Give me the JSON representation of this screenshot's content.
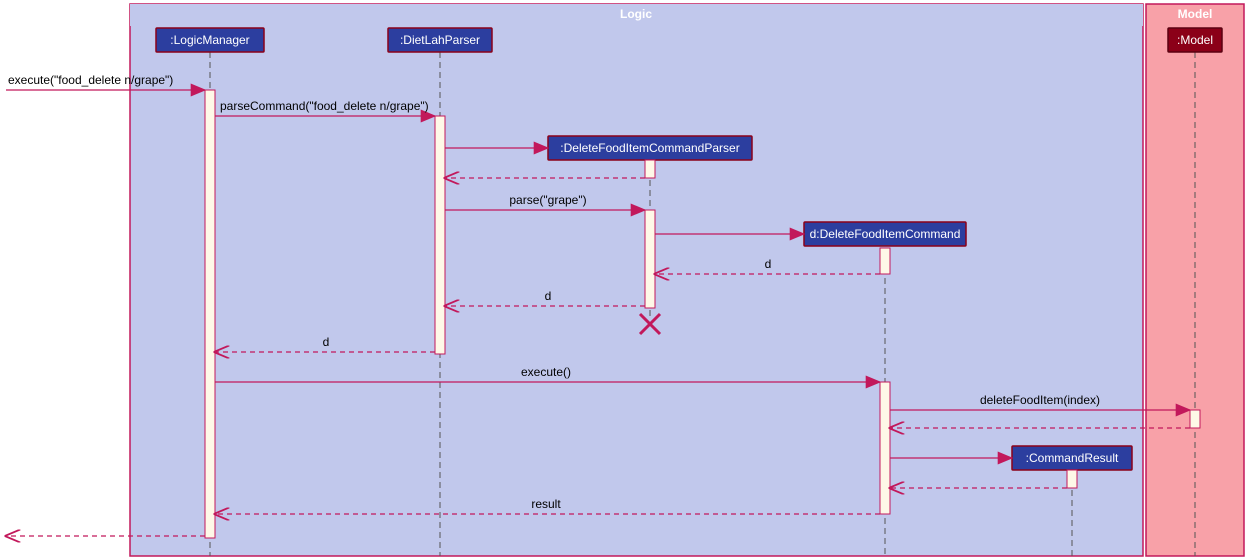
{
  "frames": {
    "logic": {
      "title": "Logic"
    },
    "model": {
      "title": "Model"
    }
  },
  "lifelines": {
    "logicManager": {
      "label": ":LogicManager"
    },
    "dietLahParser": {
      "label": ":DietLahParser"
    },
    "dfiParser": {
      "label": ":DeleteFoodItemCommandParser"
    },
    "dfiCommand": {
      "label": "d:DeleteFoodItemCommand"
    },
    "cmdResult": {
      "label": ":CommandResult"
    },
    "model": {
      "label": ":Model"
    }
  },
  "messages": {
    "m1": "execute(\"food_delete n/grape\")",
    "m2": "parseCommand(\"food_delete n/grape\")",
    "m3": "",
    "m4": "parse(\"grape\")",
    "m5": "",
    "m6": "d",
    "m7": "d",
    "m8": "d",
    "m9": "execute()",
    "m10": "deleteFoodItem(index)",
    "m11": "",
    "m12": "",
    "m13": "result",
    "m14": ""
  },
  "chart_data": {
    "type": "sequence-diagram",
    "frames": [
      {
        "name": "Logic",
        "contains": [
          "LogicManager",
          "DietLahParser",
          "DeleteFoodItemCommandParser",
          "d:DeleteFoodItemCommand",
          "CommandResult"
        ]
      },
      {
        "name": "Model",
        "contains": [
          "Model"
        ]
      }
    ],
    "lifelines": [
      ":LogicManager",
      ":DietLahParser",
      ":DeleteFoodItemCommandParser",
      "d:DeleteFoodItemCommand",
      ":CommandResult",
      ":Model"
    ],
    "interactions": [
      {
        "from": "external",
        "to": ":LogicManager",
        "label": "execute(\"food_delete n/grape\")",
        "type": "sync"
      },
      {
        "from": ":LogicManager",
        "to": ":DietLahParser",
        "label": "parseCommand(\"food_delete n/grape\")",
        "type": "sync"
      },
      {
        "from": ":DietLahParser",
        "to": ":DeleteFoodItemCommandParser",
        "label": "",
        "type": "create"
      },
      {
        "from": ":DeleteFoodItemCommandParser",
        "to": ":DietLahParser",
        "label": "",
        "type": "return"
      },
      {
        "from": ":DietLahParser",
        "to": ":DeleteFoodItemCommandParser",
        "label": "parse(\"grape\")",
        "type": "sync"
      },
      {
        "from": ":DeleteFoodItemCommandParser",
        "to": "d:DeleteFoodItemCommand",
        "label": "",
        "type": "create"
      },
      {
        "from": "d:DeleteFoodItemCommand",
        "to": ":DeleteFoodItemCommandParser",
        "label": "d",
        "type": "return"
      },
      {
        "from": ":DeleteFoodItemCommandParser",
        "to": ":DietLahParser",
        "label": "d",
        "type": "return"
      },
      {
        "from": ":DeleteFoodItemCommandParser",
        "to": null,
        "label": "",
        "type": "destroy"
      },
      {
        "from": ":DietLahParser",
        "to": ":LogicManager",
        "label": "d",
        "type": "return"
      },
      {
        "from": ":LogicManager",
        "to": "d:DeleteFoodItemCommand",
        "label": "execute()",
        "type": "sync"
      },
      {
        "from": "d:DeleteFoodItemCommand",
        "to": ":Model",
        "label": "deleteFoodItem(index)",
        "type": "sync"
      },
      {
        "from": ":Model",
        "to": "d:DeleteFoodItemCommand",
        "label": "",
        "type": "return"
      },
      {
        "from": "d:DeleteFoodItemCommand",
        "to": ":CommandResult",
        "label": "",
        "type": "create"
      },
      {
        "from": ":CommandResult",
        "to": "d:DeleteFoodItemCommand",
        "label": "",
        "type": "return"
      },
      {
        "from": "d:DeleteFoodItemCommand",
        "to": ":LogicManager",
        "label": "result",
        "type": "return"
      },
      {
        "from": ":LogicManager",
        "to": "external",
        "label": "",
        "type": "return"
      }
    ]
  }
}
